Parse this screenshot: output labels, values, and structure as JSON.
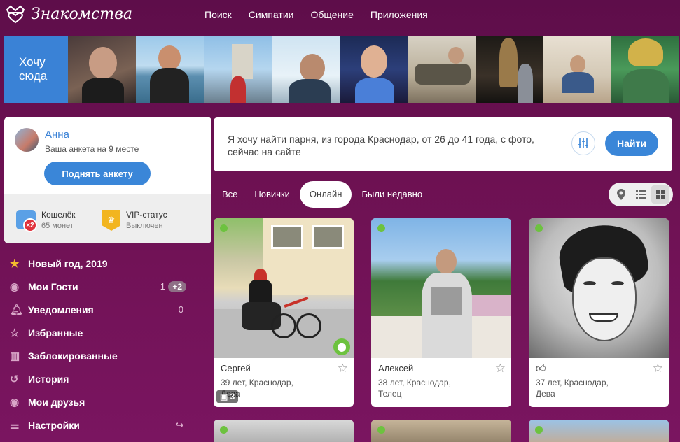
{
  "header": {
    "logo_text": "Знакомства",
    "nav": [
      "Поиск",
      "Симпатии",
      "Общение",
      "Приложения"
    ]
  },
  "strip": {
    "want_here_line1": "Хочу",
    "want_here_line2": "сюда"
  },
  "profile": {
    "name": "Анна",
    "rank_text": "Ваша анкета на 9 месте",
    "raise_button": "Поднять анкету",
    "wallet_title": "Кошелёк",
    "wallet_value": "65 монет",
    "wallet_badge": "×2",
    "vip_title": "VIP-статус",
    "vip_value": "Выключен"
  },
  "menu": {
    "new_year": "Новый год, 2019",
    "guests": "Мои Гости",
    "guests_count": "1",
    "guests_plus": "+2",
    "notifications": "Уведомления",
    "notifications_count": "0",
    "favorites": "Избранные",
    "blocked": "Заблокированные",
    "history": "История",
    "friends": "Мои друзья",
    "settings": "Настройки"
  },
  "search": {
    "query_text": "Я хочу найти парня, из города Краснодар, от 26 до 41 года, с фото, сейчас на сайте",
    "find_button": "Найти"
  },
  "tabs": [
    "Все",
    "Новички",
    "Онлайн",
    "Были недавно"
  ],
  "active_tab": "Онлайн",
  "cards": [
    {
      "name": "Сергей",
      "age_city": "39 лет, Краснодар,",
      "sign": "Дева",
      "photos": "3"
    },
    {
      "name": "Алексей",
      "age_city": "38 лет, Краснодар,",
      "sign": "Телец"
    },
    {
      "name": "",
      "age_city": "37 лет, Краснодар,",
      "sign": "Дева"
    }
  ],
  "colors": {
    "accent": "#3a86d8",
    "online": "#6dc23f",
    "background": "#6d1152"
  }
}
